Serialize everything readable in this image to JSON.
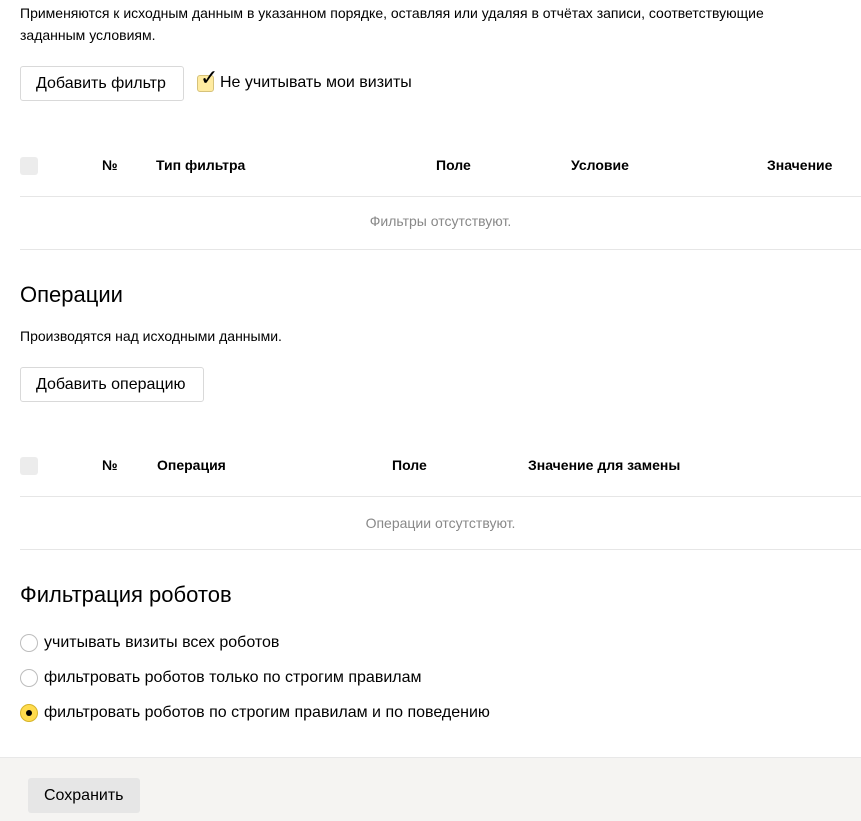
{
  "filters": {
    "description": "Применяются к исходным данным в указанном порядке, оставляя или удаляя в отчётах записи, соответствующие заданным условиям.",
    "add_button": "Добавить фильтр",
    "exclude_my_visits": {
      "label": "Не учитывать мои визиты",
      "checked": true
    },
    "table": {
      "headers": [
        "№",
        "Тип фильтра",
        "Поле",
        "Условие",
        "Значение"
      ],
      "empty_text": "Фильтры отсутствуют."
    }
  },
  "operations": {
    "title": "Операции",
    "description": "Производятся над исходными данными.",
    "add_button": "Добавить операцию",
    "table": {
      "headers": [
        "№",
        "Операция",
        "Поле",
        "Значение для замены"
      ],
      "empty_text": "Операции отсутствуют."
    }
  },
  "robots": {
    "title": "Фильтрация роботов",
    "options": [
      {
        "label": "учитывать визиты всех роботов",
        "selected": false
      },
      {
        "label": "фильтровать роботов только по строгим правилам",
        "selected": false
      },
      {
        "label": "фильтровать роботов по строгим правилам и по поведению",
        "selected": true
      }
    ]
  },
  "footer": {
    "save_button": "Сохранить"
  },
  "colors": {
    "accent": "#ffdb4d",
    "checkbox_bg": "#ffeba0",
    "footer_bg": "#f5f4f2"
  }
}
